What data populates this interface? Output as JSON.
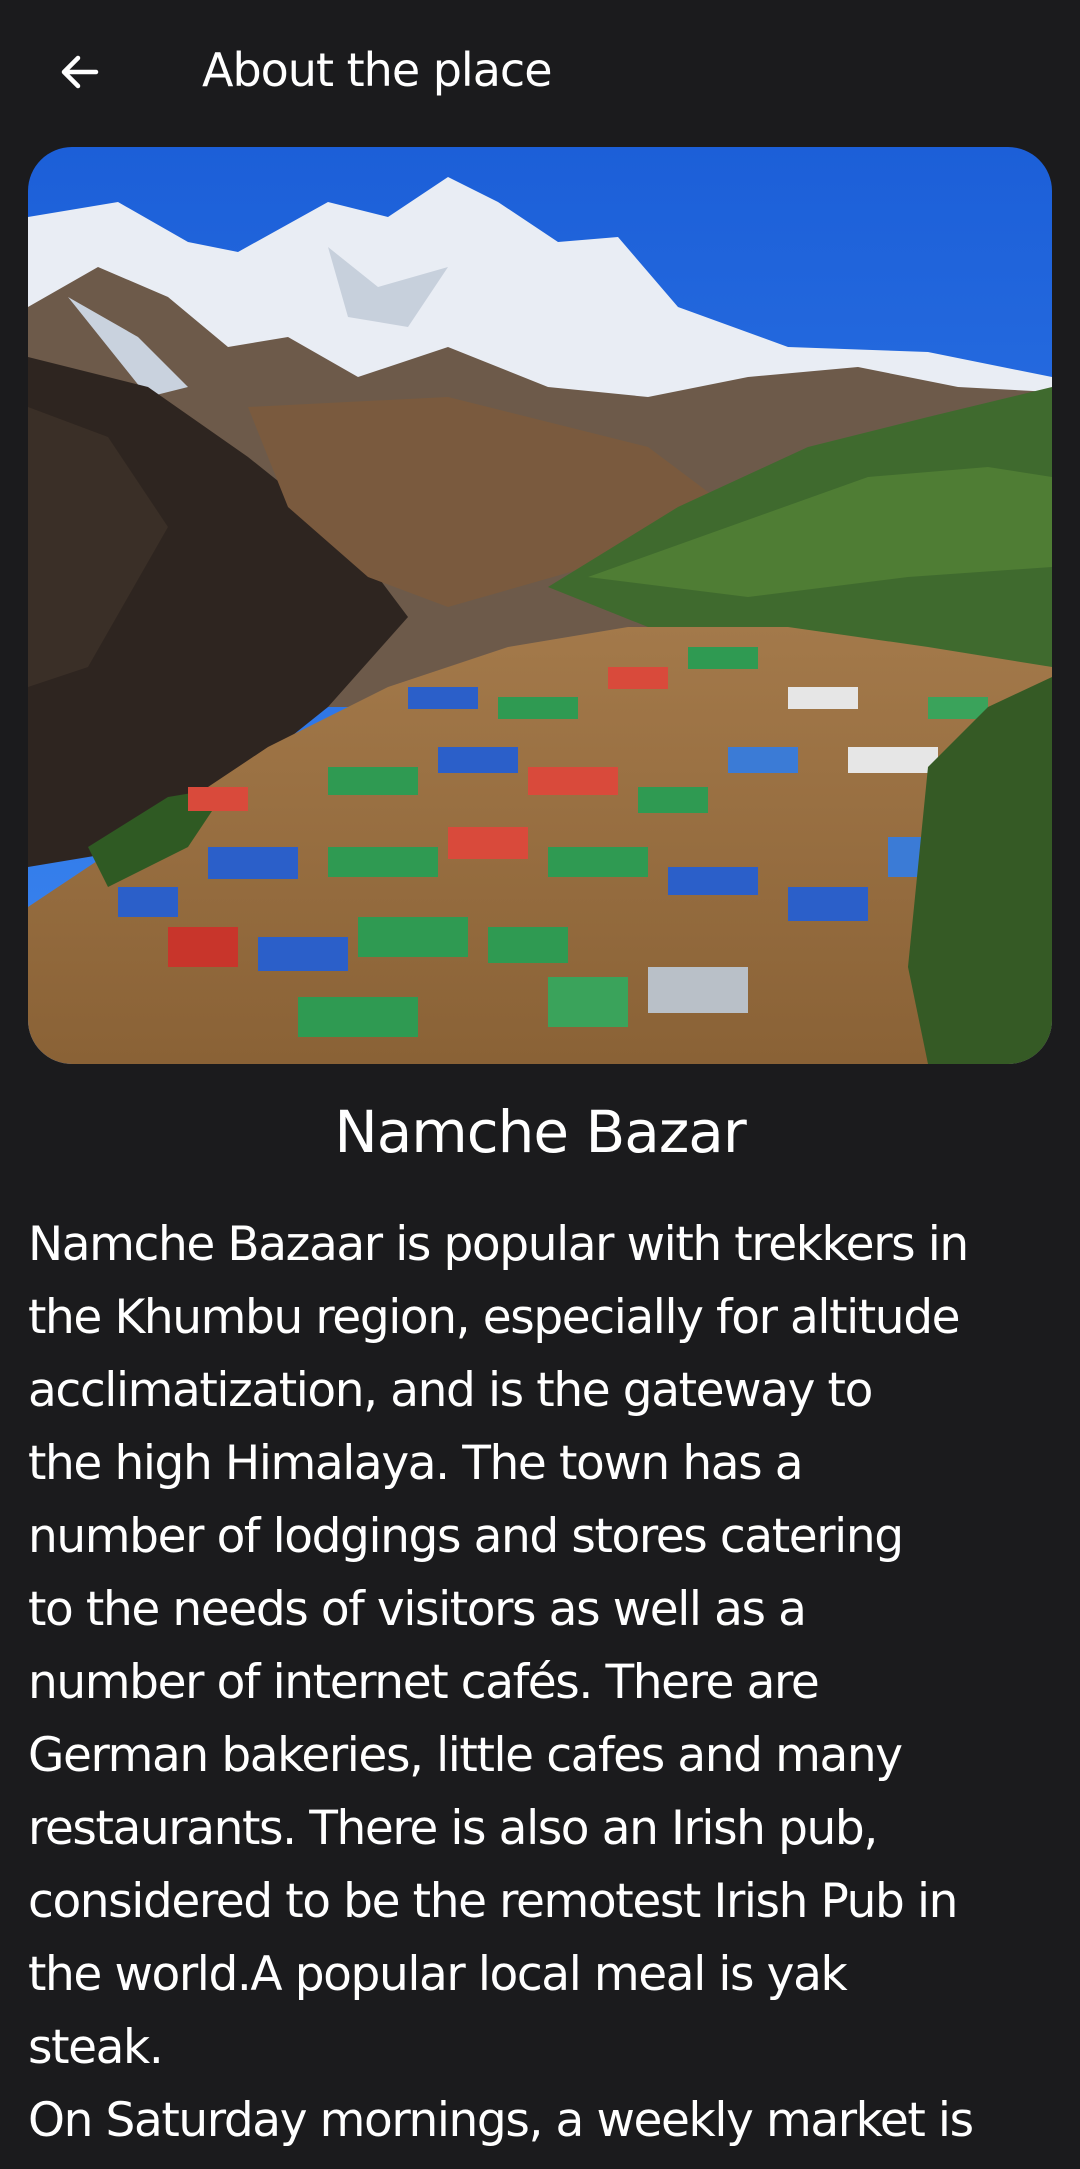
{
  "app_bar": {
    "title": "About the place",
    "back_icon": "arrow-left-icon"
  },
  "place": {
    "image_subject": "mountain-village-photo",
    "name": "Namche Bazar",
    "paragraphs": [
      "Namche Bazaar is popular with trekkers in\nthe Khumbu region, especially for altitude\nacclimatization, and is the gateway to\nthe high Himalaya. The town has a\nnumber of lodgings and stores catering\nto the needs of visitors as well as a\nnumber of internet cafés. There are\nGerman bakeries, little cafes and many\nrestaurants. There is also an Irish pub,\nconsidered to be the remotest Irish Pub in\nthe world.A popular local meal is yak\nsteak.",
      "On Saturday mornings, a weekly market is"
    ]
  },
  "colors": {
    "background": "#1b1b1d",
    "text": "#ffffff"
  }
}
